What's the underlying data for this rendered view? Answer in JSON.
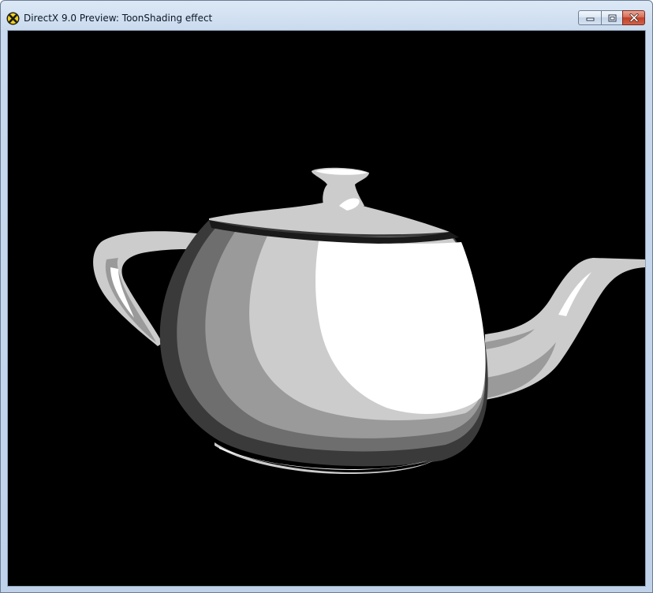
{
  "window": {
    "title": "DirectX 9.0 Preview: ToonShading effect",
    "app_icon": "directx-icon",
    "caption_buttons": {
      "minimize_icon": "minimize-icon",
      "maximize_icon": "maximize-icon",
      "close_icon": "close-icon"
    }
  },
  "viewport": {
    "background_color": "#000000",
    "rendered_object": "teapot-image",
    "shade_colors": [
      "#ffffff",
      "#cccccc",
      "#9a9a9a",
      "#6e6e6e",
      "#3a3a3a"
    ]
  }
}
